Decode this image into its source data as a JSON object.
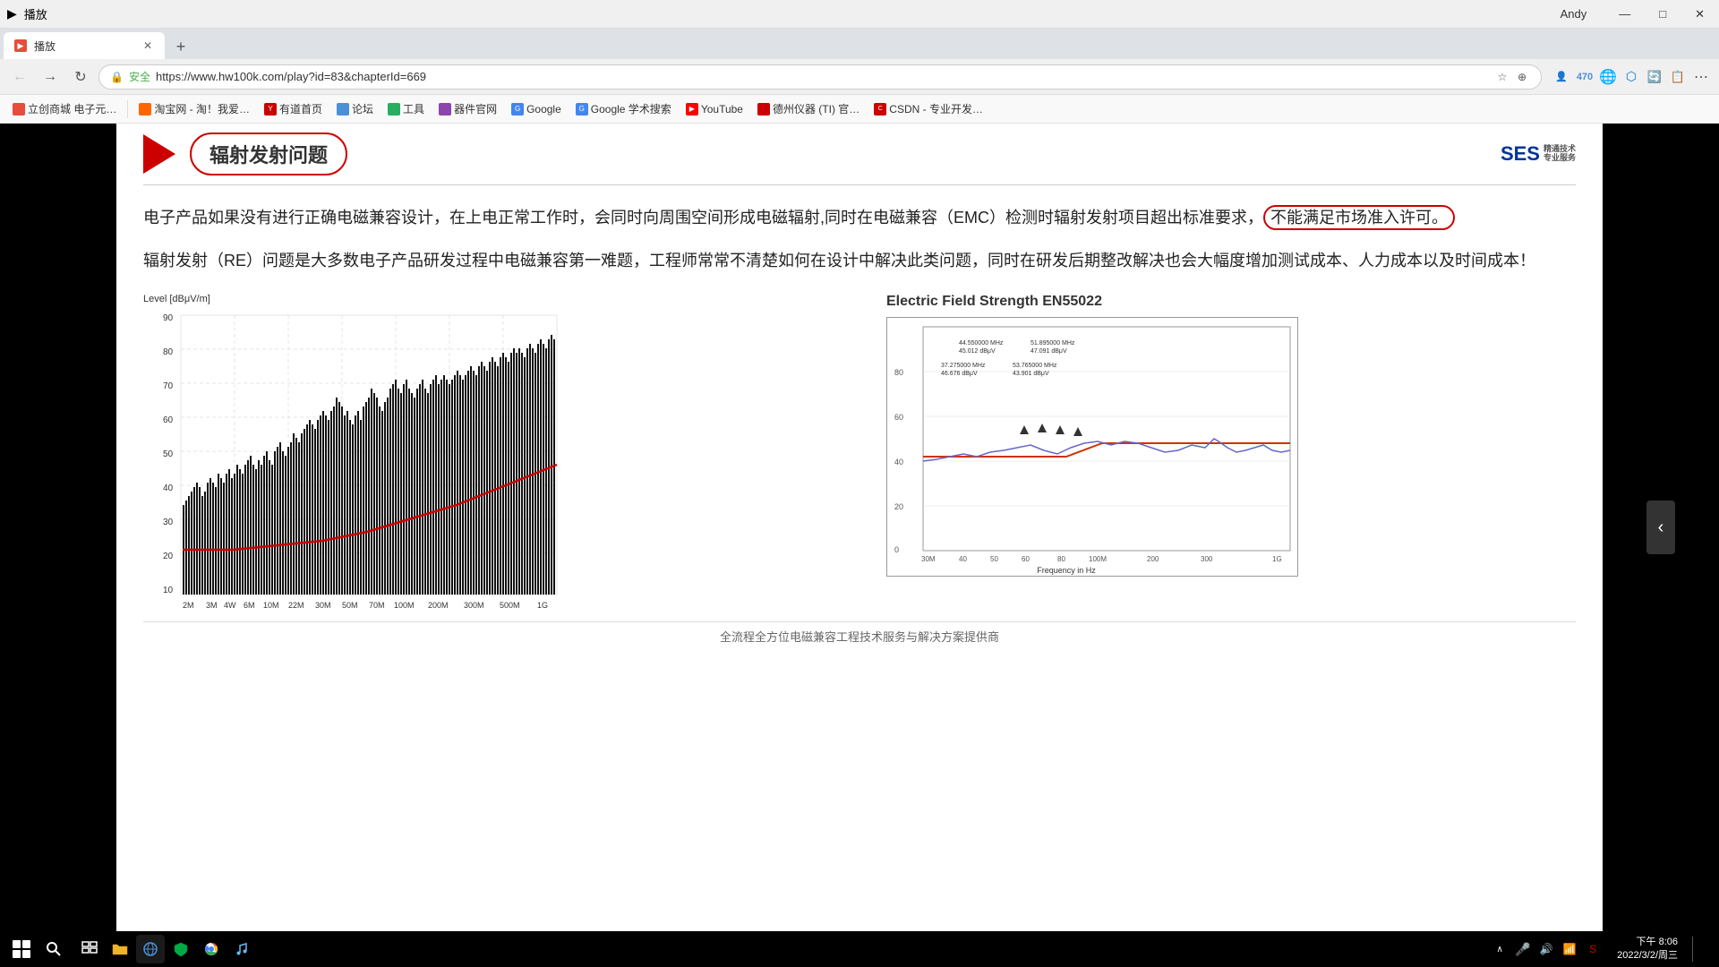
{
  "titlebar": {
    "icon_label": "播放",
    "tab_label": "播放",
    "tab_url": "hw100k.com",
    "minimize_label": "—",
    "maximize_label": "□",
    "close_label": "✕",
    "user_name": "Andy"
  },
  "addressbar": {
    "back_icon": "←",
    "forward_icon": "→",
    "refresh_icon": "↻",
    "lock_icon": "🔒",
    "security_text": "安全",
    "url": "https://www.hw100k.com/play?id=83&chapterId=669"
  },
  "bookmarks": [
    {
      "label": "立创商城 电子元…",
      "color": "#e74c3c"
    },
    {
      "label": "淘宝网 - 淘！我爱…",
      "color": "#ff6600"
    },
    {
      "label": "有道首页",
      "color": "#cc0000"
    },
    {
      "label": "论坛",
      "color": "#4a90d9"
    },
    {
      "label": "工具",
      "color": "#27ae60"
    },
    {
      "label": "器件官网",
      "color": "#8e44ad"
    },
    {
      "label": "Google",
      "color": "#4285f4"
    },
    {
      "label": "Google 学术搜索",
      "color": "#4285f4"
    },
    {
      "label": "YouTube",
      "color": "#ff0000"
    },
    {
      "label": "德州仪器 (TI) 官…",
      "color": "#cc0000"
    },
    {
      "label": "CSDN - 专业开发…",
      "color": "#cc0000"
    }
  ],
  "slide": {
    "title": "辐射发射问题",
    "ses_logo": "SES",
    "paragraph1": "电子产品如果没有进行正确电磁兼容设计，在上电正常工作时，会同时向周围空间形成电磁辐射,同时在电磁兼容（EMC）检测时辐射发射项目超出标准要求，",
    "highlight": "不能满足市场准入许可。",
    "paragraph2": "辐射发射（RE）问题是大多数电子产品研发过程中电磁兼容第一难题，工程师常常不清楚如何在设计中解决此类问题，同时在研发后期整改解决也会大幅度增加测试成本、人力成本以及时间成本！",
    "left_chart_ylabel": "Level [dBμV/m]",
    "right_chart_title": "Electric Field Strength EN55022",
    "footer": "全流程全方位电磁兼容工程技术服务与解决方案提供商"
  },
  "taskbar": {
    "search_icon": "🔍",
    "clock_time": "下午 8:06",
    "clock_date": "2022/3/2/周三",
    "start_icon": "⊞"
  }
}
